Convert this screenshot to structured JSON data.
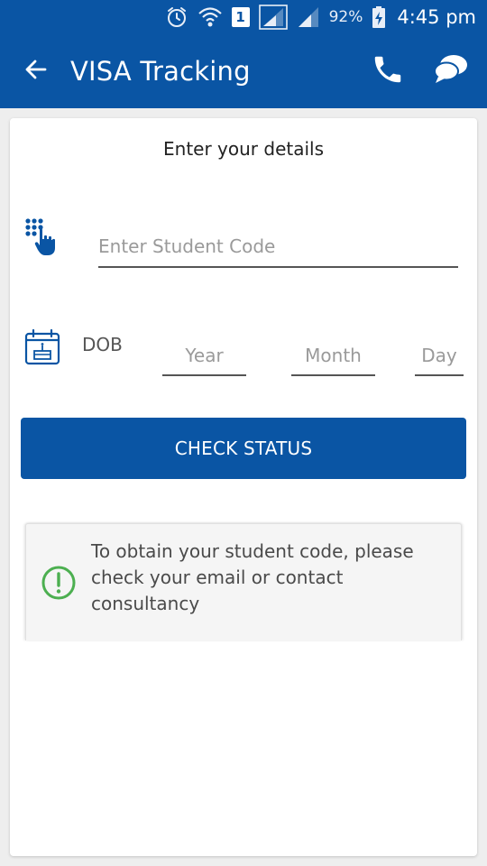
{
  "status_bar": {
    "battery_percent": "92%",
    "time": "4:45 pm",
    "sim_label": "1",
    "icons": [
      "alarm-icon",
      "wifi-icon",
      "sim-icon",
      "signal-icon",
      "signal-icon",
      "battery-charging-icon"
    ]
  },
  "app_bar": {
    "title": "VISA Tracking",
    "icons": [
      "back-arrow-icon",
      "phone-icon",
      "chat-icon"
    ]
  },
  "form": {
    "heading": "Enter your details",
    "student_code": {
      "placeholder": "Enter Student Code",
      "value": "",
      "icon": "keypad-touch-icon"
    },
    "dob": {
      "label": "DOB",
      "icon": "calendar-cake-icon",
      "year_placeholder": "Year",
      "month_placeholder": "Month",
      "day_placeholder": "Day"
    },
    "submit_label": "CHECK STATUS"
  },
  "info": {
    "icon": "exclamation-circle-icon",
    "text": "To obtain your student code, please check your email or contact consultancy"
  },
  "colors": {
    "primary": "#0a55a4",
    "info_icon": "#4caf50",
    "background": "#eeeeee",
    "card": "#ffffff"
  }
}
